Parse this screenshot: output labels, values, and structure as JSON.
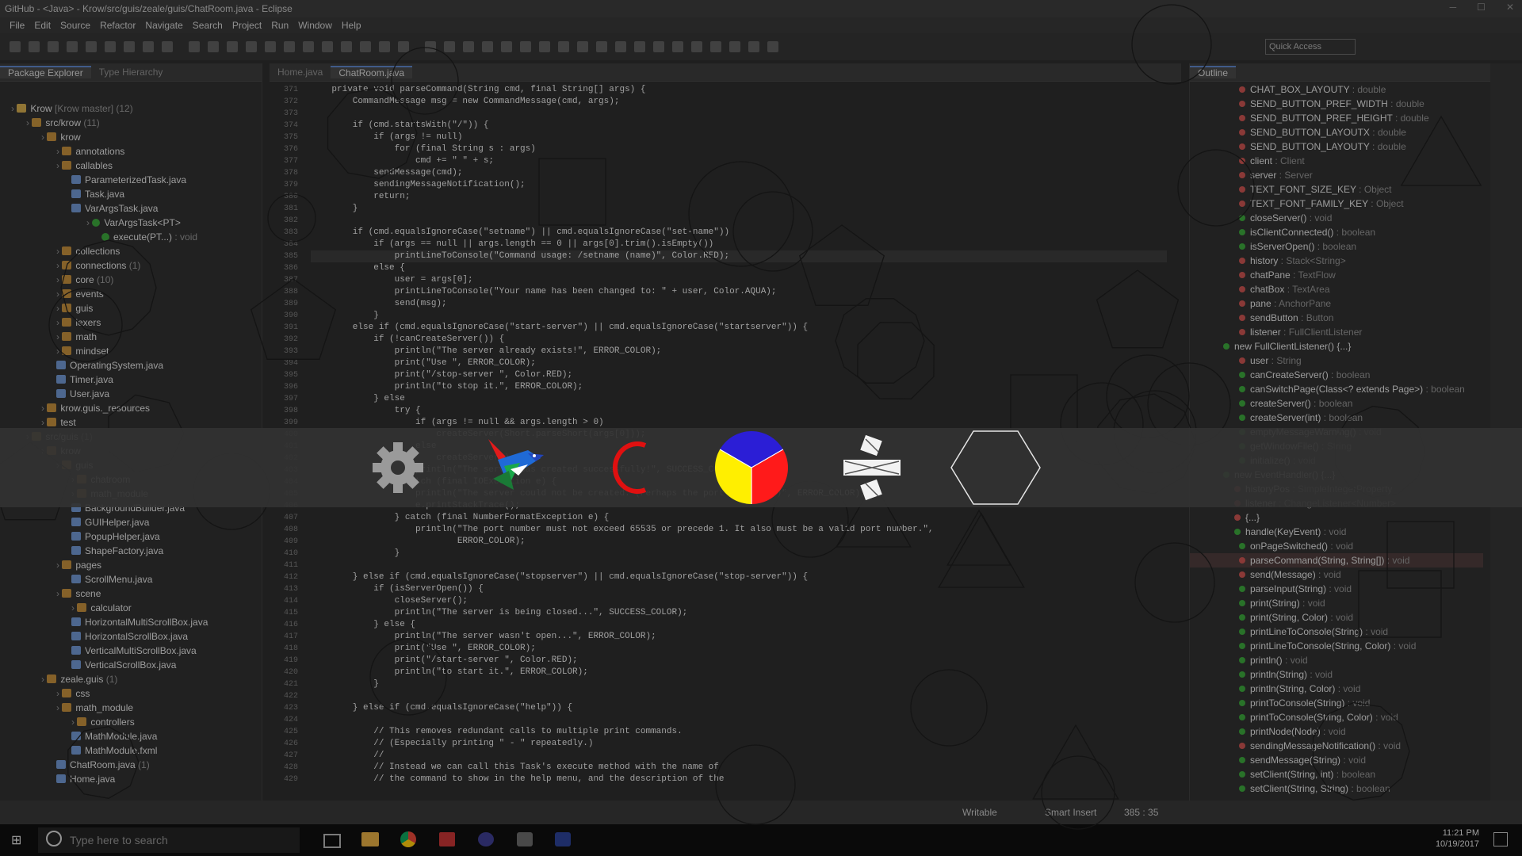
{
  "window": {
    "title": "GitHub - <Java> - Krow/src/guis/zeale/guis/ChatRoom.java - Eclipse"
  },
  "menu": [
    "File",
    "Edit",
    "Source",
    "Refactor",
    "Navigate",
    "Search",
    "Project",
    "Run",
    "Window",
    "Help"
  ],
  "toolbar": {
    "quick_access": "Quick Access"
  },
  "package_explorer": {
    "tabs": [
      "Package Explorer",
      "Type Hierarchy"
    ],
    "tree": [
      {
        "label": "Krow",
        "dec": " [Krow master] (12)",
        "depth": 0,
        "kind": "project"
      },
      {
        "label": "src/krow",
        "dec": " (11)",
        "depth": 1,
        "kind": "folder"
      },
      {
        "label": "krow",
        "dec": "",
        "depth": 2,
        "kind": "pkg"
      },
      {
        "label": "annotations",
        "dec": "",
        "depth": 3,
        "kind": "pkg"
      },
      {
        "label": "callables",
        "dec": "",
        "depth": 3,
        "kind": "pkg"
      },
      {
        "label": "ParameterizedTask.java",
        "dec": "",
        "depth": 4,
        "kind": "file"
      },
      {
        "label": "Task.java",
        "dec": "",
        "depth": 4,
        "kind": "file"
      },
      {
        "label": "VarArgsTask.java",
        "dec": "",
        "depth": 4,
        "kind": "file"
      },
      {
        "label": "VarArgsTask<PT>",
        "dec": "",
        "depth": 5,
        "kind": "class"
      },
      {
        "label": "execute(PT...)",
        "dec": " : void",
        "depth": 6,
        "kind": "method"
      },
      {
        "label": "collections",
        "dec": "",
        "depth": 3,
        "kind": "pkg"
      },
      {
        "label": "connections",
        "dec": " (1)",
        "depth": 3,
        "kind": "pkg"
      },
      {
        "label": "core",
        "dec": " (10)",
        "depth": 3,
        "kind": "pkg"
      },
      {
        "label": "events",
        "dec": "",
        "depth": 3,
        "kind": "pkg"
      },
      {
        "label": "guis",
        "dec": "",
        "depth": 3,
        "kind": "pkg"
      },
      {
        "label": "lexers",
        "dec": "",
        "depth": 3,
        "kind": "pkg"
      },
      {
        "label": "math",
        "dec": "",
        "depth": 3,
        "kind": "pkg"
      },
      {
        "label": "mindset",
        "dec": "",
        "depth": 3,
        "kind": "pkg"
      },
      {
        "label": "OperatingSystem.java",
        "dec": "",
        "depth": 3,
        "kind": "file"
      },
      {
        "label": "Timer.java",
        "dec": "",
        "depth": 3,
        "kind": "file"
      },
      {
        "label": "User.java",
        "dec": "",
        "depth": 3,
        "kind": "file"
      },
      {
        "label": "krow.guis._resources",
        "dec": "",
        "depth": 2,
        "kind": "pkg"
      },
      {
        "label": "test",
        "dec": "",
        "depth": 2,
        "kind": "pkg"
      },
      {
        "label": "src/guis",
        "dec": " (1)",
        "depth": 1,
        "kind": "folder"
      },
      {
        "label": "krow",
        "dec": "",
        "depth": 2,
        "kind": "pkg"
      },
      {
        "label": "guis",
        "dec": "",
        "depth": 3,
        "kind": "pkg"
      },
      {
        "label": "chatroom",
        "dec": "",
        "depth": 4,
        "kind": "pkg"
      },
      {
        "label": "math_module",
        "dec": "",
        "depth": 4,
        "kind": "pkg"
      },
      {
        "label": "BackgroundBuilder.java",
        "dec": "",
        "depth": 4,
        "kind": "file"
      },
      {
        "label": "GUIHelper.java",
        "dec": "",
        "depth": 4,
        "kind": "file"
      },
      {
        "label": "PopupHelper.java",
        "dec": "",
        "depth": 4,
        "kind": "file"
      },
      {
        "label": "ShapeFactory.java",
        "dec": "",
        "depth": 4,
        "kind": "file"
      },
      {
        "label": "pages",
        "dec": "",
        "depth": 3,
        "kind": "pkg"
      },
      {
        "label": "ScrollMenu.java",
        "dec": "",
        "depth": 4,
        "kind": "file"
      },
      {
        "label": "scene",
        "dec": "",
        "depth": 3,
        "kind": "pkg"
      },
      {
        "label": "calculator",
        "dec": "",
        "depth": 4,
        "kind": "pkg"
      },
      {
        "label": "HorizontalMultiScrollBox.java",
        "dec": "",
        "depth": 4,
        "kind": "file"
      },
      {
        "label": "HorizontalScrollBox.java",
        "dec": "",
        "depth": 4,
        "kind": "file"
      },
      {
        "label": "VerticalMultiScrollBox.java",
        "dec": "",
        "depth": 4,
        "kind": "file"
      },
      {
        "label": "VerticalScrollBox.java",
        "dec": "",
        "depth": 4,
        "kind": "file"
      },
      {
        "label": "zeale.guis",
        "dec": " (1)",
        "depth": 2,
        "kind": "pkg"
      },
      {
        "label": "css",
        "dec": "",
        "depth": 3,
        "kind": "pkg"
      },
      {
        "label": "math_module",
        "dec": "",
        "depth": 3,
        "kind": "pkg"
      },
      {
        "label": "controllers",
        "dec": "",
        "depth": 4,
        "kind": "pkg"
      },
      {
        "label": "MathModule.java",
        "dec": "",
        "depth": 4,
        "kind": "file"
      },
      {
        "label": "MathModule.fxml",
        "dec": "",
        "depth": 4,
        "kind": "file"
      },
      {
        "label": "ChatRoom.java",
        "dec": " (1)",
        "depth": 3,
        "kind": "file"
      },
      {
        "label": "Home.java",
        "dec": "",
        "depth": 3,
        "kind": "file"
      }
    ]
  },
  "editor": {
    "tabs": [
      "Home.java",
      "ChatRoom.java"
    ],
    "active_tab": 1,
    "first_line": 371,
    "lines": [
      "    private void parseCommand(String cmd, final String[] args) {",
      "        CommandMessage msg = new CommandMessage(cmd, args);",
      "",
      "        if (cmd.startsWith(\"/\")) {",
      "            if (args != null)",
      "                for (final String s : args)",
      "                    cmd += \" \" + s;",
      "            sendMessage(cmd);",
      "            sendingMessageNotification();",
      "            return;",
      "        }",
      "",
      "        if (cmd.equalsIgnoreCase(\"setname\") || cmd.equalsIgnoreCase(\"set-name\"))",
      "            if (args == null || args.length == 0 || args[0].trim().isEmpty())",
      "                printLineToConsole(\"Command usage: /setname (name)\", Color.RED);",
      "            else {",
      "                user = args[0];",
      "                printLineToConsole(\"Your name has been changed to: \" + user, Color.AQUA);",
      "                send(msg);",
      "            }",
      "        else if (cmd.equalsIgnoreCase(\"start-server\") || cmd.equalsIgnoreCase(\"startserver\")) {",
      "            if (!canCreateServer()) {",
      "                println(\"The server already exists!\", ERROR_COLOR);",
      "                print(\"Use \", ERROR_COLOR);",
      "                print(\"/stop-server \", Color.RED);",
      "                println(\"to stop it.\", ERROR_COLOR);",
      "            } else",
      "                try {",
      "                    if (args != null && args.length > 0)",
      "                        createServer(Short.parseShort(args[0]));",
      "                    else",
      "                        createServer();",
      "                    println(\"The server was created successfully!\", SUCCESS_COLOR);",
      "                } catch (final IOException e) {",
      "                    println(\"The server could not be created. (Perhaps the port is taken?)\", ERROR_COLOR);",
      "                    e.printStackTrace();",
      "                } catch (final NumberFormatException e) {",
      "                    println(\"The port number must not exceed 65535 or precede 1. It also must be a valid port number.\",",
      "                            ERROR_COLOR);",
      "                }",
      "",
      "        } else if (cmd.equalsIgnoreCase(\"stopserver\") || cmd.equalsIgnoreCase(\"stop-server\")) {",
      "            if (isServerOpen()) {",
      "                closeServer();",
      "                println(\"The server is being closed...\", SUCCESS_COLOR);",
      "            } else {",
      "                println(\"The server wasn't open...\", ERROR_COLOR);",
      "                print(\"Use \", ERROR_COLOR);",
      "                print(\"/start-server \", Color.RED);",
      "                println(\"to start it.\", ERROR_COLOR);",
      "            }",
      "",
      "        } else if (cmd.equalsIgnoreCase(\"help\")) {",
      "",
      "            // This removes redundant calls to multiple print commands.",
      "            // (Especially printing \" - \" repeatedly.)",
      "            //",
      "            // Instead we can call this Task's execute method with the name of",
      "            // the command to show in the help menu, and the description of the"
    ]
  },
  "outline": {
    "tab": "Outline",
    "items": [
      {
        "name": "CHAT_BOX_LAYOUTY",
        "type": " : double",
        "color": "#c0504d"
      },
      {
        "name": "SEND_BUTTON_PREF_WIDTH",
        "type": " : double",
        "color": "#c0504d"
      },
      {
        "name": "SEND_BUTTON_PREF_HEIGHT",
        "type": " : double",
        "color": "#c0504d"
      },
      {
        "name": "SEND_BUTTON_LAYOUTX",
        "type": " : double",
        "color": "#c0504d"
      },
      {
        "name": "SEND_BUTTON_LAYOUTY",
        "type": " : double",
        "color": "#c0504d"
      },
      {
        "name": "client",
        "type": " : Client",
        "color": "#c0504d"
      },
      {
        "name": "server",
        "type": " : Server",
        "color": "#c0504d"
      },
      {
        "name": "TEXT_FONT_SIZE_KEY",
        "type": " : Object",
        "color": "#c0504d"
      },
      {
        "name": "TEXT_FONT_FAMILY_KEY",
        "type": " : Object",
        "color": "#c0504d"
      },
      {
        "name": "closeServer()",
        "type": " : void",
        "color": "#3a9e3a"
      },
      {
        "name": "isClientConnected()",
        "type": " : boolean",
        "color": "#3a9e3a"
      },
      {
        "name": "isServerOpen()",
        "type": " : boolean",
        "color": "#3a9e3a"
      },
      {
        "name": "history",
        "type": " : Stack<String>",
        "color": "#c0504d"
      },
      {
        "name": "chatPane",
        "type": " : TextFlow",
        "color": "#c0504d"
      },
      {
        "name": "chatBox",
        "type": " : TextArea",
        "color": "#c0504d"
      },
      {
        "name": "pane",
        "type": " : AnchorPane",
        "color": "#c0504d"
      },
      {
        "name": "sendButton",
        "type": " : Button",
        "color": "#c0504d"
      },
      {
        "name": "listener",
        "type": " : FullClientListener",
        "color": "#c0504d"
      },
      {
        "name": "new FullClientListener() {...}",
        "type": "",
        "color": "#3a9e3a"
      },
      {
        "name": "user",
        "type": " : String",
        "color": "#c0504d"
      },
      {
        "name": "canCreateServer()",
        "type": " : boolean",
        "color": "#3a9e3a"
      },
      {
        "name": "canSwitchPage(Class<? extends Page>)",
        "type": " : boolean",
        "color": "#3a9e3a"
      },
      {
        "name": "createServer()",
        "type": " : boolean",
        "color": "#3a9e3a"
      },
      {
        "name": "createServer(int)",
        "type": " : boolean",
        "color": "#3a9e3a"
      },
      {
        "name": "emptyMessageWarning()",
        "type": " : void",
        "color": "#3a9e3a"
      },
      {
        "name": "getWindowFile()",
        "type": " : String",
        "color": "#3a9e3a"
      },
      {
        "name": "initialize()",
        "type": " : void",
        "color": "#3a9e3a"
      },
      {
        "name": "new EventHandler() {...}",
        "type": "",
        "color": "#3a9e3a"
      },
      {
        "name": "historyPos",
        "type": " : SimpleIntegerProperty",
        "color": "#c0504d"
      },
      {
        "name": "listener",
        "type": " : ChangeListener<Number>",
        "color": "#c0504d"
      },
      {
        "name": "{...}",
        "type": "",
        "color": "#c0504d"
      },
      {
        "name": "handle(KeyEvent)",
        "type": " : void",
        "color": "#3a9e3a"
      },
      {
        "name": "onPageSwitched()",
        "type": " : void",
        "color": "#3a9e3a"
      },
      {
        "name": "parseCommand(String, String[])",
        "type": " : void",
        "color": "#c0504d"
      },
      {
        "name": "send(Message)",
        "type": " : void",
        "color": "#c0504d"
      },
      {
        "name": "parseInput(String)",
        "type": " : void",
        "color": "#3a9e3a"
      },
      {
        "name": "print(String)",
        "type": " : void",
        "color": "#3a9e3a"
      },
      {
        "name": "print(String, Color)",
        "type": " : void",
        "color": "#3a9e3a"
      },
      {
        "name": "printLineToConsole(String)",
        "type": " : void",
        "color": "#3a9e3a"
      },
      {
        "name": "printLineToConsole(String, Color)",
        "type": " : void",
        "color": "#3a9e3a"
      },
      {
        "name": "println()",
        "type": " : void",
        "color": "#3a9e3a"
      },
      {
        "name": "println(String)",
        "type": " : void",
        "color": "#3a9e3a"
      },
      {
        "name": "println(String, Color)",
        "type": " : void",
        "color": "#3a9e3a"
      },
      {
        "name": "printToConsole(String)",
        "type": " : void",
        "color": "#3a9e3a"
      },
      {
        "name": "printToConsole(String, Color)",
        "type": " : void",
        "color": "#3a9e3a"
      },
      {
        "name": "printNode(Node)",
        "type": " : void",
        "color": "#3a9e3a"
      },
      {
        "name": "sendingMessageNotification()",
        "type": " : void",
        "color": "#c0504d"
      },
      {
        "name": "sendMessage(String)",
        "type": " : void",
        "color": "#3a9e3a"
      },
      {
        "name": "setClient(String, int)",
        "type": " : boolean",
        "color": "#3a9e3a"
      },
      {
        "name": "setClient(String, String)",
        "type": " : boolean",
        "color": "#3a9e3a"
      }
    ]
  },
  "status": {
    "writable": "Writable",
    "insert_mode": "Smart Insert",
    "position": "385 : 35"
  },
  "taskbar": {
    "search_placeholder": "Type here to search",
    "time": "11:21 PM",
    "date": "10/19/2017"
  },
  "overlay_icons": [
    "gear-icon",
    "bird-icon",
    "c-letter-icon",
    "pie-chart-icon",
    "divide-icon",
    "hexagon-icon"
  ],
  "colors": {
    "accent": "#5a7fbf",
    "error": "#ff0000",
    "pie_blue": "#2b1ed6",
    "pie_red": "#ff1a1a",
    "pie_yellow": "#ffef00"
  }
}
